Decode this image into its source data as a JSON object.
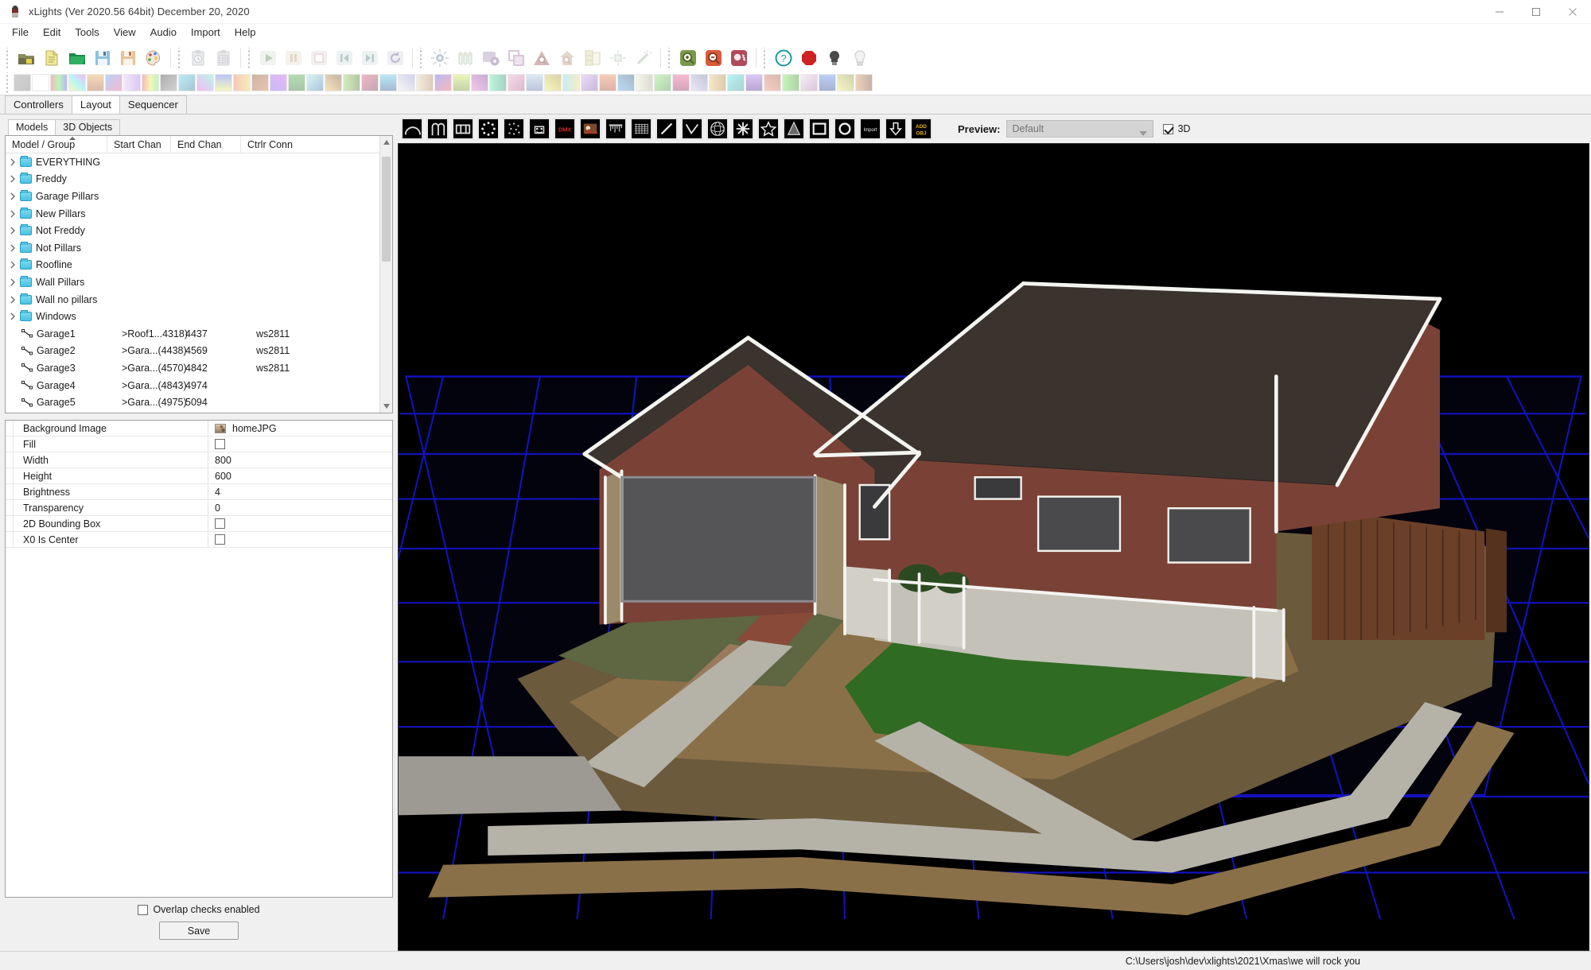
{
  "window": {
    "title": "xLights (Ver 2020.56 64bit) December 20, 2020",
    "app_icon": "santa-icon",
    "minimize": "minimize-icon",
    "maximize": "maximize-icon",
    "close": "close-icon"
  },
  "menu": [
    "File",
    "Edit",
    "Tools",
    "View",
    "Audio",
    "Import",
    "Help"
  ],
  "toolbar": {
    "groups": [
      {
        "name": "file",
        "items": [
          {
            "icon": "new-sequence-icon",
            "color": "#6e6e4e",
            "disabled": false
          },
          {
            "icon": "new-document-icon",
            "color": "#e3dc8a",
            "disabled": false
          },
          {
            "icon": "open-folder-icon",
            "color": "#2f9e5f",
            "disabled": false
          },
          {
            "icon": "save-icon",
            "color": "#7fb8d8",
            "disabled": false
          },
          {
            "icon": "save-as-icon",
            "color": "#e3b98a",
            "disabled": false
          },
          {
            "icon": "palette-icon",
            "color": "#d87b7b",
            "disabled": false
          }
        ]
      },
      {
        "name": "edit",
        "items": [
          {
            "icon": "clipboard-clock-icon",
            "color": "#9aa7b4",
            "disabled": true
          },
          {
            "icon": "grid-paste-icon",
            "color": "#9aa7b4",
            "disabled": true
          }
        ]
      },
      {
        "name": "playback",
        "items": [
          {
            "icon": "play-icon",
            "color": "#4caf50",
            "disabled": true
          },
          {
            "icon": "pause-icon",
            "color": "#e6a97a",
            "disabled": true
          },
          {
            "icon": "stop-icon",
            "color": "#e08a8a",
            "disabled": true
          },
          {
            "icon": "rewind-icon",
            "color": "#7fc4c4",
            "disabled": true
          },
          {
            "icon": "fast-forward-icon",
            "color": "#7fc4c4",
            "disabled": true
          },
          {
            "icon": "replay-icon",
            "color": "#9a8ad8",
            "disabled": true
          }
        ]
      },
      {
        "name": "models",
        "items": [
          {
            "icon": "effects-burst-icon",
            "color": "#4a8ac9",
            "disabled": true
          },
          {
            "icon": "render-all-icon",
            "color": "#8fc98f",
            "disabled": true
          },
          {
            "icon": "model-gear-icon",
            "color": "#9a6ec9",
            "disabled": true
          },
          {
            "icon": "layers-icon",
            "color": "#c96ec9",
            "disabled": true
          },
          {
            "icon": "check-sequence-icon",
            "color": "#d84a4a",
            "disabled": true
          },
          {
            "icon": "house-search-icon",
            "color": "#e59a5a",
            "disabled": true
          },
          {
            "icon": "color-manager-icon",
            "color": "#d8c85a",
            "disabled": true
          },
          {
            "icon": "twinkle-icon",
            "color": "#8fc98f",
            "disabled": true
          },
          {
            "icon": "magic-wand-icon",
            "color": "#8fb98f",
            "disabled": true
          }
        ]
      },
      {
        "name": "zoom",
        "items": [
          {
            "icon": "zoom-in-icon",
            "color": "#6a8f4a",
            "disabled": false
          },
          {
            "icon": "zoom-out-icon",
            "color": "#d85a3a",
            "disabled": false
          },
          {
            "icon": "zoom-settings-icon",
            "color": "#b04a5a",
            "disabled": false
          }
        ]
      },
      {
        "name": "help",
        "items": [
          {
            "icon": "help-icon",
            "color": "#1a9aa0",
            "disabled": false
          },
          {
            "icon": "stop-octagon-icon",
            "color": "#cc2222",
            "disabled": false
          },
          {
            "icon": "bulb-off-icon",
            "color": "#4a4a4a",
            "disabled": false
          },
          {
            "icon": "bulb-on-icon",
            "color": "#e8e8e8",
            "disabled": false
          }
        ]
      }
    ],
    "effect_icons": [
      "off-effect-icon",
      "on-effect-icon",
      "bars-effect-icon",
      "butterfly-effect-icon",
      "candle-effect-icon",
      "circles-effect-icon",
      "color-wash-effect-icon",
      "curtain-effect-icon",
      "dmx-effect-icon",
      "faces-effect-icon",
      "fan-effect-icon",
      "fire-effect-icon",
      "fireworks-effect-icon",
      "galaxy-effect-icon",
      "garlands-effect-icon",
      "glediator-effect-icon",
      "kaleidoscope-effect-icon",
      "life-effect-icon",
      "lightning-effect-icon",
      "liquid-effect-icon",
      "marquee-effect-icon",
      "meteors-effect-icon",
      "morph-effect-icon",
      "music-effect-icon",
      "off2-effect-icon",
      "piano-effect-icon",
      "pictures-effect-icon",
      "pinwheel-effect-icon",
      "plasma-effect-icon",
      "ripple-effect-icon",
      "shader-effect-icon",
      "shockwave-effect-icon",
      "single-strand-effect-icon",
      "sketch-effect-icon",
      "snowflakes-effect-icon",
      "snowstorm-effect-icon",
      "spirals-effect-icon",
      "spirograph-effect-icon",
      "state-effect-icon",
      "strobe-effect-icon",
      "tendril-effect-icon",
      "text-effect-icon",
      "tree-effect-icon",
      "twinkle-effect-icon",
      "vumeter-effect-icon",
      "warp-effect-icon",
      "wave-effect-icon"
    ]
  },
  "main_tabs": [
    {
      "label": "Controllers",
      "active": false
    },
    {
      "label": "Layout",
      "active": true
    },
    {
      "label": "Sequencer",
      "active": false
    }
  ],
  "left_panel": {
    "sub_tabs": [
      {
        "label": "Models",
        "active": true
      },
      {
        "label": "3D Objects",
        "active": false
      }
    ],
    "tree": {
      "columns": [
        "Model / Group",
        "Start Chan",
        "End Chan",
        "Ctrlr Conn"
      ],
      "sorted_column": "Model / Group",
      "sort_direction": "asc",
      "rows": [
        {
          "type": "group",
          "name": "EVERYTHING",
          "start": "",
          "end": "",
          "ctrl": ""
        },
        {
          "type": "group",
          "name": "Freddy",
          "start": "",
          "end": "",
          "ctrl": ""
        },
        {
          "type": "group",
          "name": "Garage Pillars",
          "start": "",
          "end": "",
          "ctrl": ""
        },
        {
          "type": "group",
          "name": "New Pillars",
          "start": "",
          "end": "",
          "ctrl": ""
        },
        {
          "type": "group",
          "name": "Not Freddy",
          "start": "",
          "end": "",
          "ctrl": ""
        },
        {
          "type": "group",
          "name": "Not Pillars",
          "start": "",
          "end": "",
          "ctrl": ""
        },
        {
          "type": "group",
          "name": "Roofline",
          "start": "",
          "end": "",
          "ctrl": ""
        },
        {
          "type": "group",
          "name": "Wall Pillars",
          "start": "",
          "end": "",
          "ctrl": ""
        },
        {
          "type": "group",
          "name": "Wall no pillars",
          "start": "",
          "end": "",
          "ctrl": ""
        },
        {
          "type": "group",
          "name": "Windows",
          "start": "",
          "end": "",
          "ctrl": ""
        },
        {
          "type": "model",
          "name": "Garage1",
          "start": ">Roof1...4318)",
          "end": "4437",
          "ctrl": "ws2811"
        },
        {
          "type": "model",
          "name": "Garage2",
          "start": ">Gara...(4438)",
          "end": "4569",
          "ctrl": "ws2811"
        },
        {
          "type": "model",
          "name": "Garage3",
          "start": ">Gara...(4570)",
          "end": "4842",
          "ctrl": "ws2811"
        },
        {
          "type": "model",
          "name": "Garage4",
          "start": ">Gara...(4843)",
          "end": "4974",
          "ctrl": ""
        },
        {
          "type": "model",
          "name": "Garage5",
          "start": ">Gara...(4975)",
          "end": "5094",
          "ctrl": ""
        }
      ]
    },
    "properties": [
      {
        "label": "Background Image",
        "type": "image",
        "value": "homeJPG_thumb",
        "text": "homeJPG"
      },
      {
        "label": "Fill",
        "type": "checkbox",
        "checked": false
      },
      {
        "label": "Width",
        "type": "text",
        "value": "800"
      },
      {
        "label": "Height",
        "type": "text",
        "value": "600"
      },
      {
        "label": "Brightness",
        "type": "text",
        "value": "4"
      },
      {
        "label": "Transparency",
        "type": "text",
        "value": "0"
      },
      {
        "label": "2D Bounding Box",
        "type": "checkbox",
        "checked": false
      },
      {
        "label": "X0 Is Center",
        "type": "checkbox",
        "checked": false
      }
    ],
    "overlap_label": "Overlap checks enabled",
    "overlap_checked": false,
    "save_label": "Save"
  },
  "preview": {
    "model_buttons": [
      "arches-model-icon",
      "candy-cane-model-icon",
      "channel-block-model-icon",
      "circle-model-icon",
      "custom-model-icon",
      "cube-model-icon",
      "dmx-model-icon",
      "image-model-icon",
      "icicle-model-icon",
      "matrix-model-icon",
      "single-line-model-icon",
      "poly-line-model-icon",
      "sphere-model-icon",
      "spinner-model-icon",
      "star-model-icon",
      "tree-model-icon",
      "window-frame-model-icon",
      "wreath-model-icon",
      "import-model-icon",
      "download-model-icon",
      "add-object-icon"
    ],
    "label": "Preview:",
    "selected": "Default",
    "select_disabled": true,
    "three_d_label": "3D",
    "three_d_checked": true,
    "scene_name": "house-3d-preview"
  },
  "statusbar": {
    "path": "C:\\Users\\josh\\dev\\xlights\\2021\\Xmas\\we will rock you"
  },
  "colors": {
    "grid_blue": "#1414c8",
    "canvas_bg": "#000000",
    "brick": "#7a4236",
    "roof": "#3a332e",
    "led_white": "#f4f4f0",
    "grass": "#2f6b23",
    "concrete": "#b5b2a8",
    "mulch": "#6b4a3a",
    "dirt": "#8a7048",
    "fence": "#6b4028",
    "garage_door": "#555558"
  }
}
